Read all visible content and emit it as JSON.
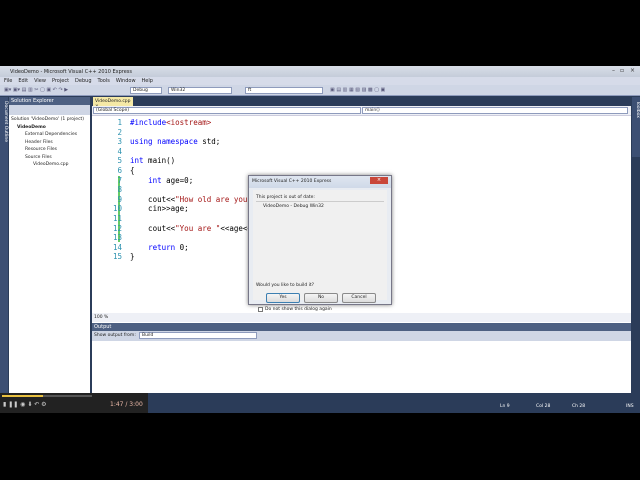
{
  "window": {
    "title": "VideoDemo - Microsoft Visual C++ 2010 Express"
  },
  "menu": [
    "File",
    "Edit",
    "View",
    "Project",
    "Debug",
    "Tools",
    "Window",
    "Help"
  ],
  "toolbar": {
    "config": "Debug",
    "platform": "Win32",
    "find": "ft"
  },
  "solution_explorer": {
    "title": "Solution Explorer",
    "items": [
      "Solution 'VideoDemo' (1 project)",
      "VideoDemo",
      "External Dependencies",
      "Header Files",
      "Resource Files",
      "Source Files",
      "VideoDemo.cpp"
    ]
  },
  "side_tabs": {
    "left": "Document Outline",
    "right": "Toolbox"
  },
  "editor": {
    "tab": "VideoDemo.cpp",
    "scope": "(Global Scope)",
    "member": "main()",
    "zoom": "100 %"
  },
  "code": [
    "#include<iostream>",
    "",
    "using namespace std;",
    "",
    "int main()",
    "{",
    "    int age=0;",
    "",
    "    cout<<\"How old are you?\";",
    "    cin>>age;",
    "",
    "    cout<<\"You are \"<<age<<",
    "",
    "    return 0;",
    "}"
  ],
  "output": {
    "title": "Output",
    "show_from_label": "Show output from:",
    "source": "Build"
  },
  "status": {
    "ln": "Ln 9",
    "col": "Col 28",
    "ch": "Ch 28",
    "mode": "INS"
  },
  "player": {
    "time": "1:47 / 3:00"
  },
  "dialog": {
    "title": "Microsoft Visual C++ 2010 Express",
    "message": "This project is out of date:",
    "detail": "VideoDemo - Debug Win32",
    "question": "Would you like to build it?",
    "yes": "Yes",
    "no": "No",
    "cancel": "Cancel",
    "checkbox": "Do not show this dialog again"
  }
}
